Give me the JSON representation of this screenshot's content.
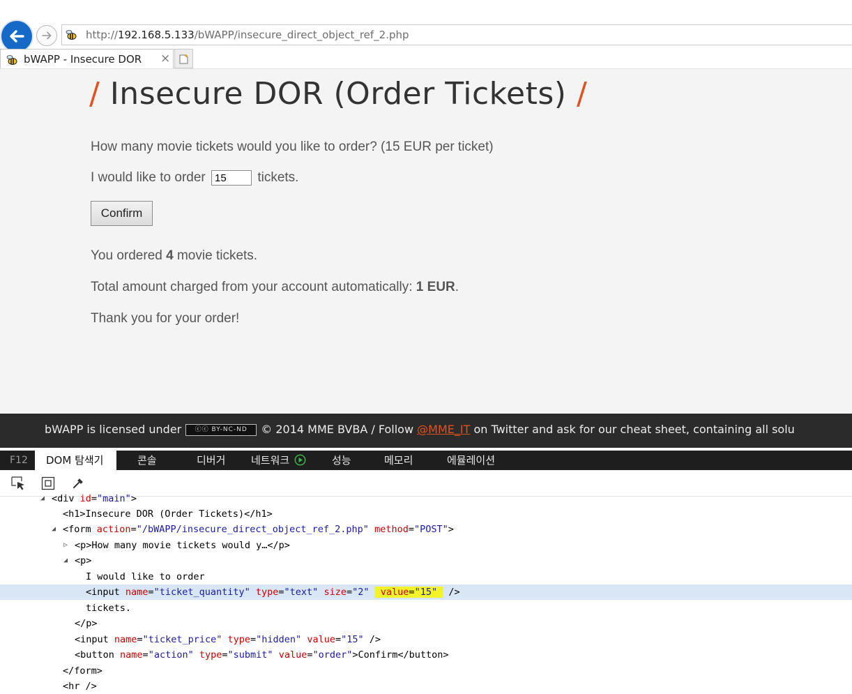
{
  "browser": {
    "url_prefix": "http://",
    "url_host": "192.168.5.133",
    "url_path": "/bWAPP/insecure_direct_object_ref_2.php",
    "tab_title": "bWAPP - Insecure DOR",
    "tab_close": "×"
  },
  "page": {
    "slash": "/",
    "title": "Insecure DOR (Order Tickets)",
    "question": "How many movie tickets would you like to order? (15 EUR per ticket)",
    "order_prefix": "I would like to order",
    "order_suffix": "tickets.",
    "quantity_value": "15",
    "confirm_label": "Confirm",
    "ordered_prefix": "You ordered",
    "ordered_count": "4",
    "ordered_suffix": "movie tickets.",
    "total_prefix": "Total amount charged from your account automatically:",
    "total_amount": "1 EUR",
    "total_suffix": ".",
    "thanks": "Thank you for your order!"
  },
  "footer": {
    "licensed": "bWAPP is licensed under",
    "cc_badge": "BY-NC-ND",
    "copyright": "© 2014 MME BVBA / Follow",
    "twitter": "@MME_IT",
    "rest": "on Twitter and ask for our cheat sheet, containing all solu"
  },
  "devtools": {
    "f12": "F12",
    "tabs": [
      "DOM 탐색기",
      "콘솔",
      "디버거",
      "네트워크",
      "성능",
      "메모리",
      "에뮬레이션"
    ],
    "dom": {
      "l1": {
        "open": "<div ",
        "a1": "id",
        "v1": "\"main\"",
        "close": ">"
      },
      "l2": "<h1>Insecure DOR (Order Tickets)</h1>",
      "l3": {
        "open": "<form ",
        "a1": "action",
        "v1": "\"/bWAPP/insecure_direct_object_ref_2.php\"",
        "a2": "method",
        "v2": "\"POST\"",
        "close": ">"
      },
      "l4": "<p>How many movie tickets would y…</p>",
      "l5": "<p>",
      "l6": "I would like to order",
      "l7": {
        "open": "<input ",
        "a1": "name",
        "v1": "\"ticket_quantity\"",
        "a2": "type",
        "v2": "\"text\"",
        "a3": "size",
        "v3": "\"2\"",
        "a4": "value",
        "v4": "\"15\"",
        "close": " />"
      },
      "l8": "tickets.",
      "l9": "</p>",
      "l10": {
        "open": "<input ",
        "a1": "name",
        "v1": "\"ticket_price\"",
        "a2": "type",
        "v2": "\"hidden\"",
        "a3": "value",
        "v3": "\"15\"",
        "close": " />"
      },
      "l11": {
        "open": "<button ",
        "a1": "name",
        "v1": "\"action\"",
        "a2": "type",
        "v2": "\"submit\"",
        "a3": "value",
        "v3": "\"order\"",
        "close": ">Confirm</button>"
      },
      "l12": "</form>",
      "l13": "<hr />"
    }
  },
  "colors": {
    "accent": "#e2521f",
    "back_button": "#1569c7",
    "selection": "#d8e6f5",
    "highlight": "#f3f32a"
  }
}
